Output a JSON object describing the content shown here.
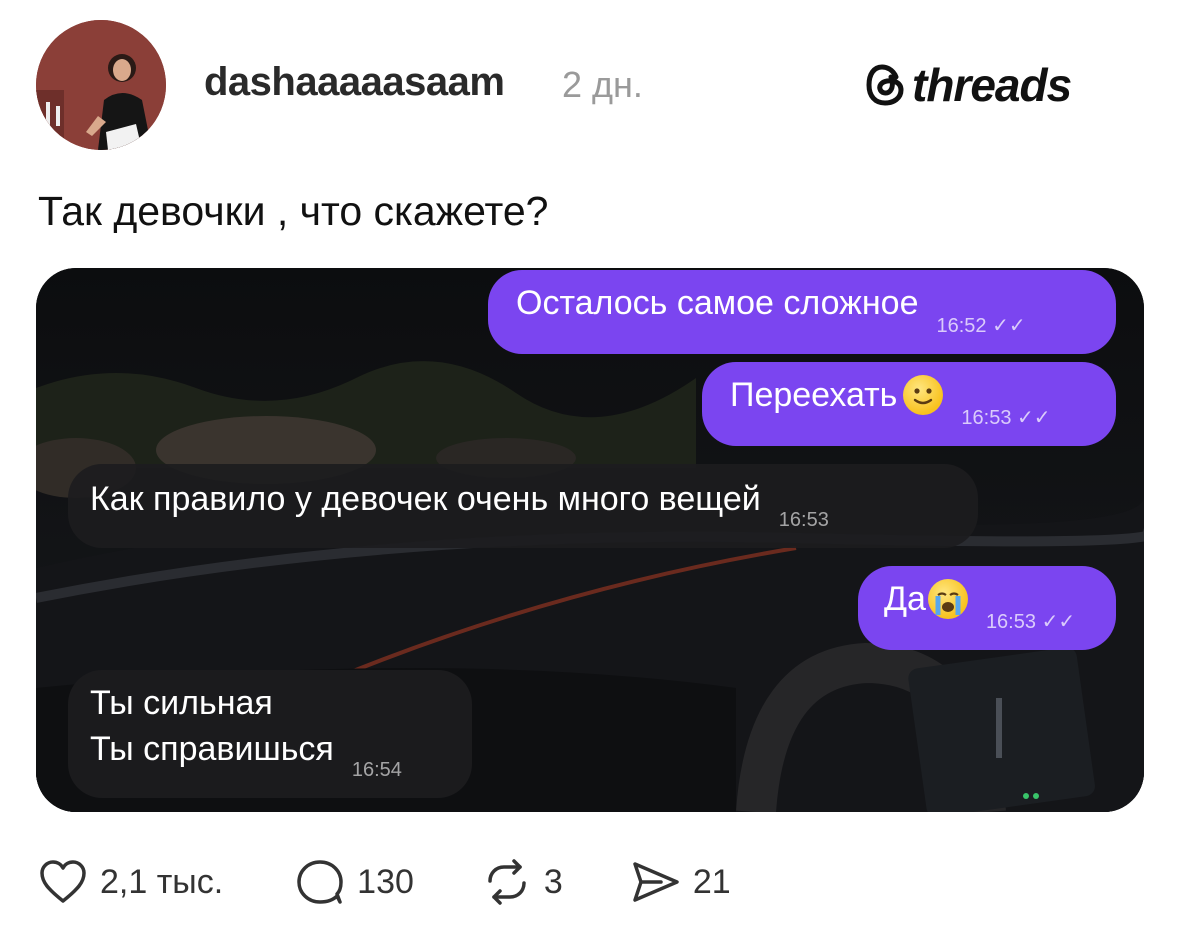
{
  "header": {
    "username": "dashaaaaasaam",
    "time": "2 дн.",
    "brand": "threads"
  },
  "post": {
    "text": "Так девочки , что скажете?"
  },
  "chat": {
    "messages": [
      {
        "side": "out",
        "text": "Осталось самое сложное",
        "time": "16:52",
        "ticks": "✓✓"
      },
      {
        "side": "out",
        "text": "Переехать",
        "emoji": "slightly-smiling-face",
        "time": "16:53",
        "ticks": "✓✓"
      },
      {
        "side": "in",
        "text": "Как правило у девочек очень много вещей",
        "time": "16:53"
      },
      {
        "side": "out",
        "text": "Да",
        "emoji": "crying-face",
        "time": "16:53",
        "ticks": "✓✓"
      },
      {
        "side": "in",
        "text": "Ты сильная\nТы справишься",
        "time": "16:54"
      }
    ]
  },
  "actions": {
    "likes": "2,1 тыс.",
    "comments": "130",
    "reposts": "3",
    "shares": "21"
  },
  "colors": {
    "outgoing_bubble": "#7b45f0",
    "incoming_bubble": "#1c1c1e"
  }
}
